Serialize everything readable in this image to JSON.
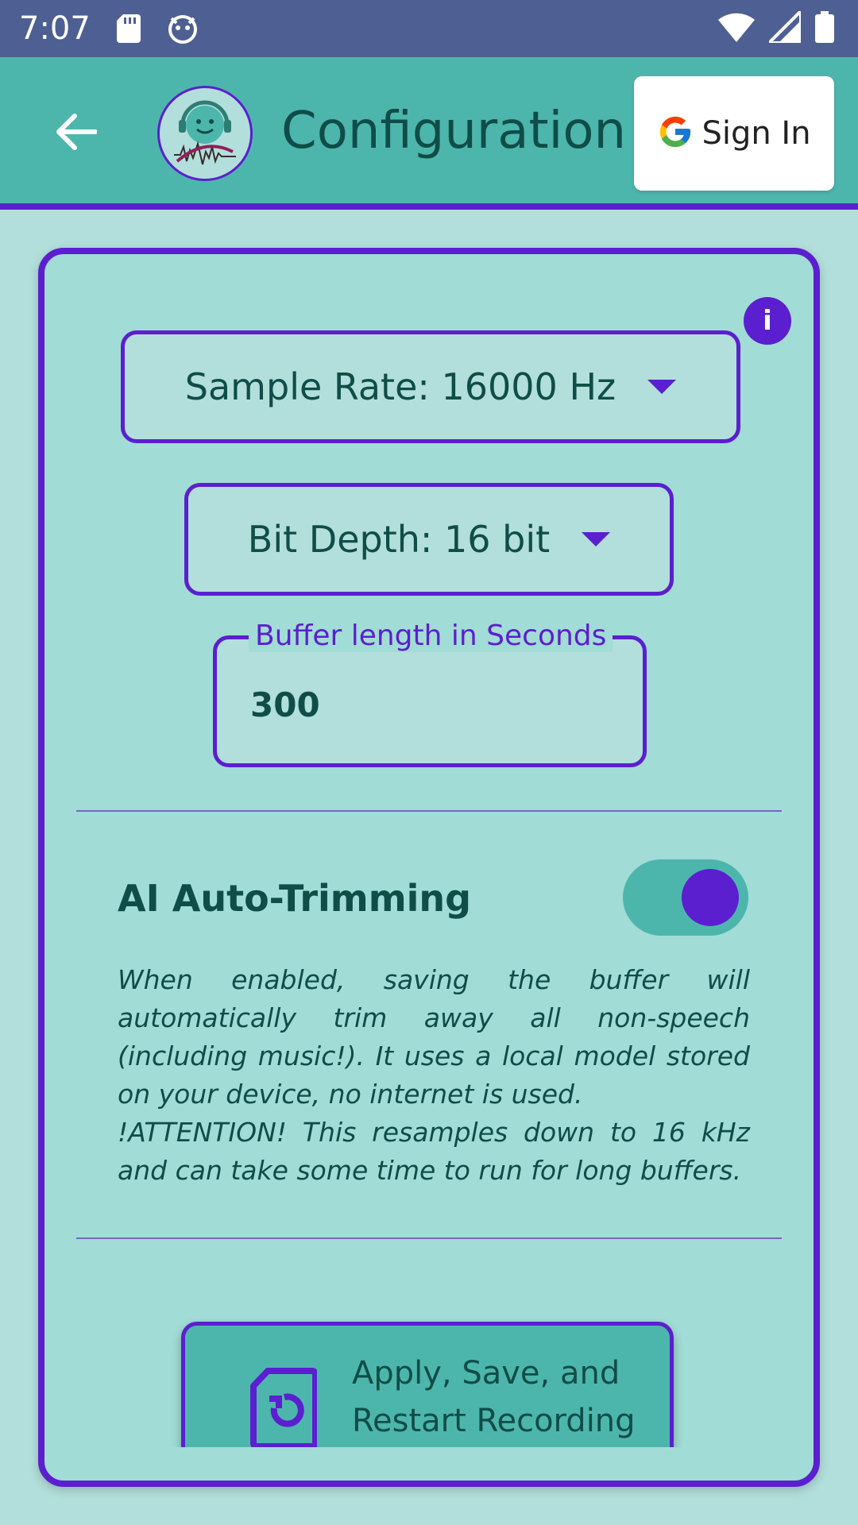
{
  "status_bar": {
    "time": "7:07"
  },
  "app_bar": {
    "title": "Configuration",
    "sign_in_label": "Sign In"
  },
  "config": {
    "sample_rate_label": "Sample Rate: 16000 Hz",
    "bit_depth_label": "Bit Depth: 16 bit",
    "buffer_label": "Buffer length in Seconds",
    "buffer_value": "300",
    "ai_trim_label": "AI Auto-Trimming",
    "ai_trim_enabled": true,
    "ai_trim_description": "When enabled, saving the buffer will automatically trim away all non-speech (including music!). It uses a local model stored on your device, no internet is used.\n!ATTENTION! This resamples down to 16 kHz and can take some time to run for long buffers.",
    "apply_button_label": "Apply, Save, and Restart Recording"
  },
  "colors": {
    "accent": "#5b1fd0",
    "app_bar": "#4db6ac",
    "background": "#b2dfdb",
    "status_bar": "#4e5f93"
  },
  "icons": {
    "back": "arrow-left-icon",
    "info": "info-icon",
    "apply": "file-restart-icon",
    "google": "google-g-icon"
  }
}
